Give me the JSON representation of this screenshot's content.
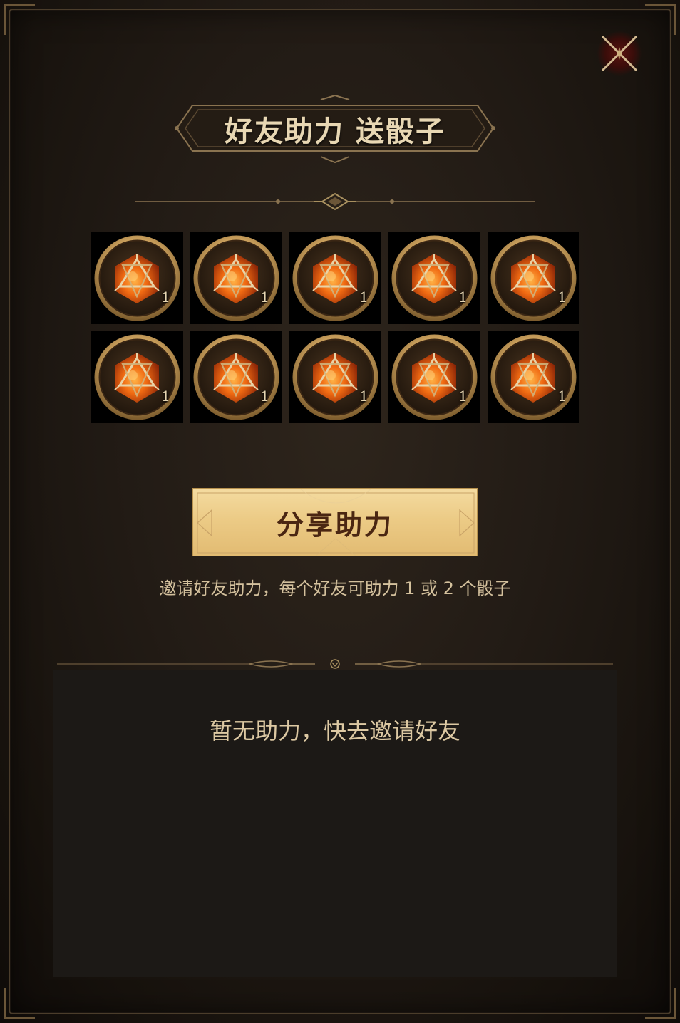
{
  "header": {
    "title": "好友助力  送骰子",
    "close_icon": "close-icon"
  },
  "rewards": {
    "item_icon": "d20-dice-icon",
    "items": [
      {
        "count": "1"
      },
      {
        "count": "1"
      },
      {
        "count": "1"
      },
      {
        "count": "1"
      },
      {
        "count": "1"
      },
      {
        "count": "1"
      },
      {
        "count": "1"
      },
      {
        "count": "1"
      },
      {
        "count": "1"
      },
      {
        "count": "1"
      }
    ]
  },
  "share": {
    "button_label": "分享助力",
    "hint": "邀请好友助力，每个好友可助力 1 或 2 个骰子"
  },
  "helpers": {
    "empty_text": "暂无助力，快去邀请好友"
  },
  "colors": {
    "panel_bg": "#221b15",
    "gold_text": "#e8d7b3",
    "button_gold": "#eccb86",
    "button_text": "#4a2612",
    "list_bg": "#1c1916"
  }
}
